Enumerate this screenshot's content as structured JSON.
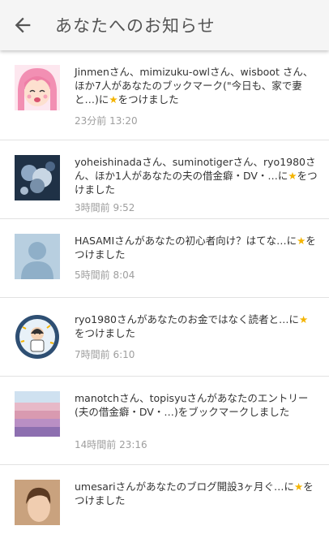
{
  "header": {
    "title": "あなたへのお知らせ",
    "back_icon": "arrow-left-icon"
  },
  "notifications": [
    {
      "line1": "Jinmenさん、mimizuku-owlさん、wisboot さん、ほか7人があなたのブックマーク(\"今日も、家で妻と…)に",
      "suffix": "をつけました",
      "time": "23分前 13:20",
      "avatar": "anime-girl-avatar",
      "star": true
    },
    {
      "line1": "yoheishinadaさん、suminotigerさん、ryo1980さん、ほか1人があなたの夫の借金癖・DV・…に",
      "suffix": "をつけました",
      "time": "3時間前 9:52",
      "avatar": "photo-avatar",
      "star": true
    },
    {
      "line1": "HASAMIさんがあなたの初心者向け？はてな…に",
      "suffix": "をつけました",
      "time": "5時間前 8:04",
      "avatar": "default-user-avatar",
      "star": true
    },
    {
      "line1": "ryo1980さんがあなたのお金ではなく読者と…に",
      "suffix": "をつけました",
      "time": "7時間前 6:10",
      "avatar": "cartoon-avatar",
      "star": true
    },
    {
      "line1": "manotchさん、topisyuさんがあなたのエントリー(夫の借金癖・DV・…)をブックマークしました",
      "suffix": "",
      "time": "14時間前 23:16",
      "avatar": "flower-field-avatar",
      "star": false
    },
    {
      "line1": "umesariさんがあなたのブログ開設3ヶ月ぐ…に",
      "suffix": "をつけました",
      "time": "",
      "avatar": "woman-photo-avatar",
      "star": true
    }
  ],
  "star_glyph": "★",
  "colors": {
    "star": "#f4b400",
    "time": "#9e9e9e",
    "header_bg": "#f5f5f5"
  }
}
